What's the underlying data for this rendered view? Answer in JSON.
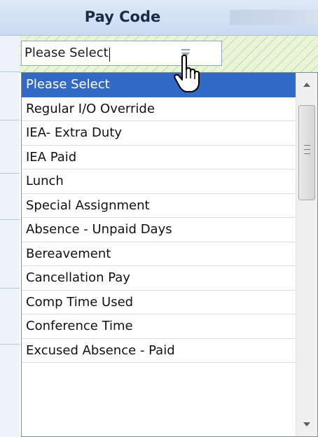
{
  "header": {
    "title": "Pay Code"
  },
  "select": {
    "value": "Please Select"
  },
  "dropdown": {
    "options": [
      "Please Select",
      "Regular I/O Override",
      "IEA- Extra Duty",
      "IEA Paid",
      "Lunch",
      "Special Assignment",
      "Absence - Unpaid Days",
      "Bereavement",
      "Cancellation Pay",
      "Comp Time Used",
      "Conference Time",
      "Excused Absence - Paid"
    ],
    "selected_index": 0
  },
  "colors": {
    "selected_bg": "#3169c6",
    "header_bg": "#c9dbf1",
    "filter_bg": "#e9f5d6"
  },
  "icons": [
    "scroll-up-arrow-icon",
    "scroll-down-arrow-icon",
    "dropdown-arrow-icon",
    "hand-pointer-cursor-icon"
  ]
}
